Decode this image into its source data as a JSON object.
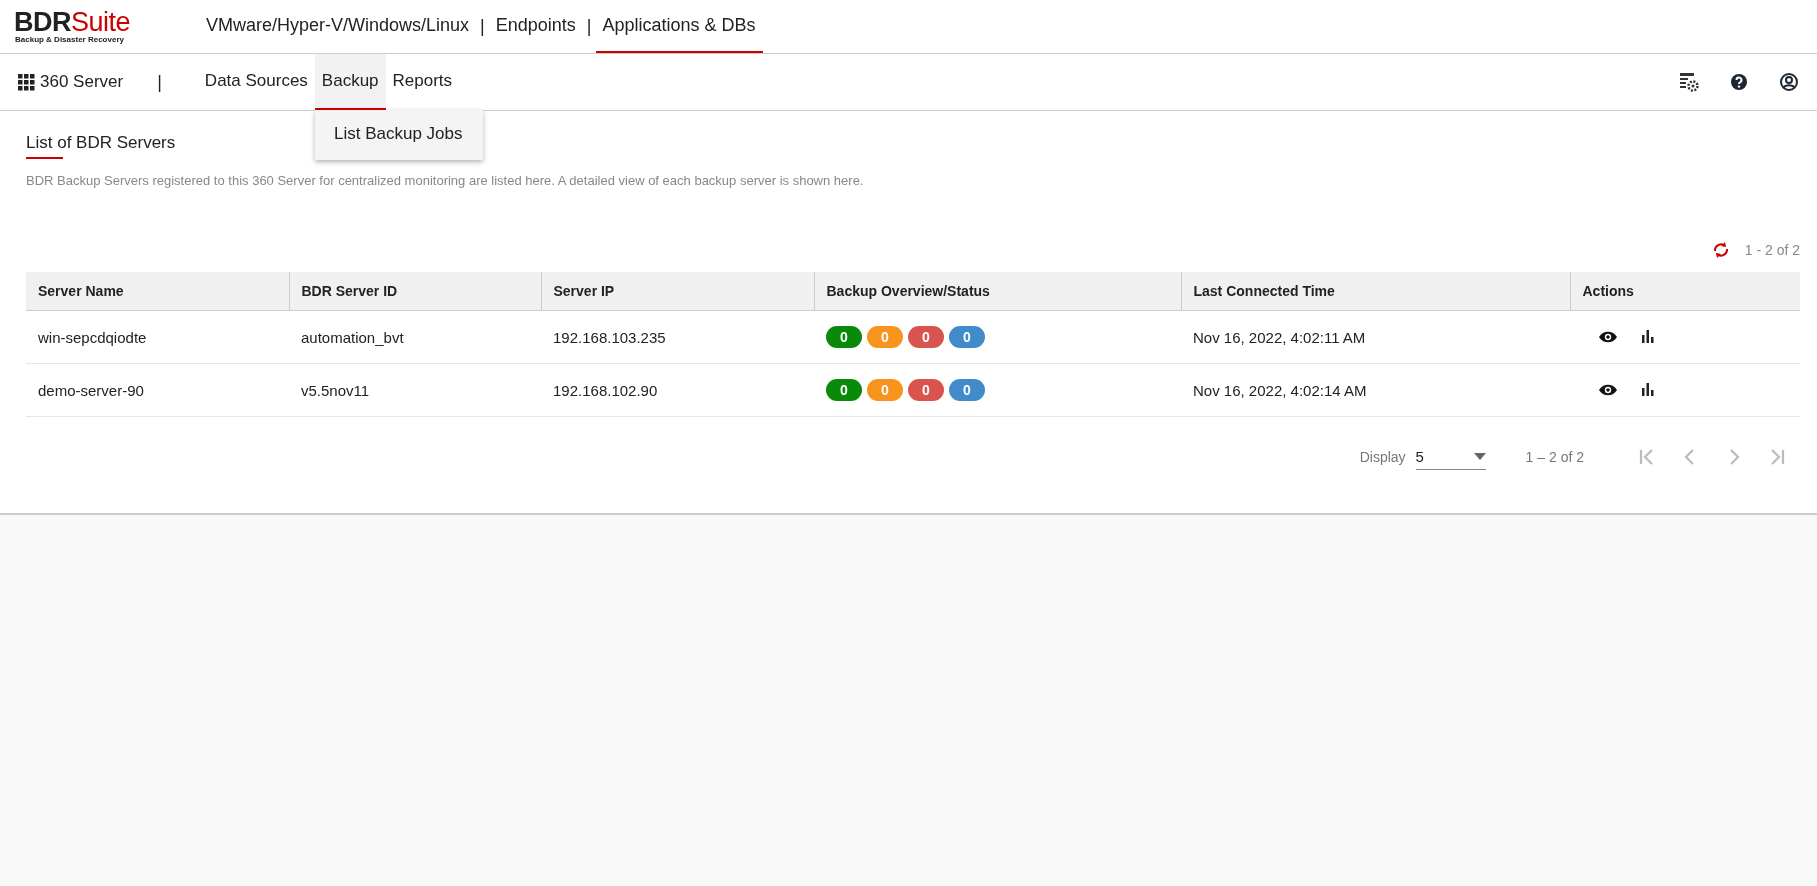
{
  "brand": {
    "name": "BDR",
    "name_accent": "Suite",
    "tagline": "Backup & Disaster Recovery"
  },
  "top_nav": [
    {
      "label": "VMware/Hyper-V/Windows/Linux",
      "selected": false
    },
    {
      "label": "|",
      "kind": "separator"
    },
    {
      "label": "Endpoints",
      "selected": false
    },
    {
      "label": "|",
      "kind": "separator"
    },
    {
      "label": "Applications & DBs",
      "selected": true
    }
  ],
  "sub_nav": {
    "app_label": "360 Server",
    "separator": "|",
    "items": [
      {
        "label": "Data Sources",
        "selected": false
      },
      {
        "label": "Backup",
        "selected": true
      },
      {
        "label": "Reports",
        "selected": false
      }
    ]
  },
  "dropdown": {
    "items": [
      "List Backup Jobs"
    ]
  },
  "page": {
    "title": "List of BDR Servers",
    "description": "BDR Backup Servers registered to this 360 Server for centralized monitoring are listed here. A detailed view of each backup server is shown here.",
    "count": "1 - 2 of 2"
  },
  "table": {
    "columns": [
      "Server Name",
      "BDR Server ID",
      "Server IP",
      "Backup Overview/Status",
      "Last Connected Time",
      "Actions"
    ],
    "rows": [
      {
        "server_name": "win-sepcdqiodte",
        "server_id": "automation_bvt",
        "server_ip": "192.168.103.235",
        "status": [
          {
            "value": "0",
            "color": "#0a8a0a"
          },
          {
            "value": "0",
            "color": "#f7941d"
          },
          {
            "value": "0",
            "color": "#d9534f"
          },
          {
            "value": "0",
            "color": "#428bca"
          }
        ],
        "last_connected": "Nov 16, 2022, 4:02:11 AM"
      },
      {
        "server_name": "demo-server-90",
        "server_id": "v5.5nov11",
        "server_ip": "192.168.102.90",
        "status": [
          {
            "value": "0",
            "color": "#0a8a0a"
          },
          {
            "value": "0",
            "color": "#f7941d"
          },
          {
            "value": "0",
            "color": "#d9534f"
          },
          {
            "value": "0",
            "color": "#428bca"
          }
        ],
        "last_connected": "Nov 16, 2022, 4:02:14 AM"
      }
    ]
  },
  "paginator": {
    "label": "Display",
    "page_size": "5",
    "range": "1 – 2 of 2",
    "buttons": [
      {
        "kind": "first",
        "disabled": true
      },
      {
        "kind": "prev",
        "disabled": true
      },
      {
        "kind": "next",
        "disabled": true
      },
      {
        "kind": "last",
        "disabled": true
      }
    ]
  }
}
